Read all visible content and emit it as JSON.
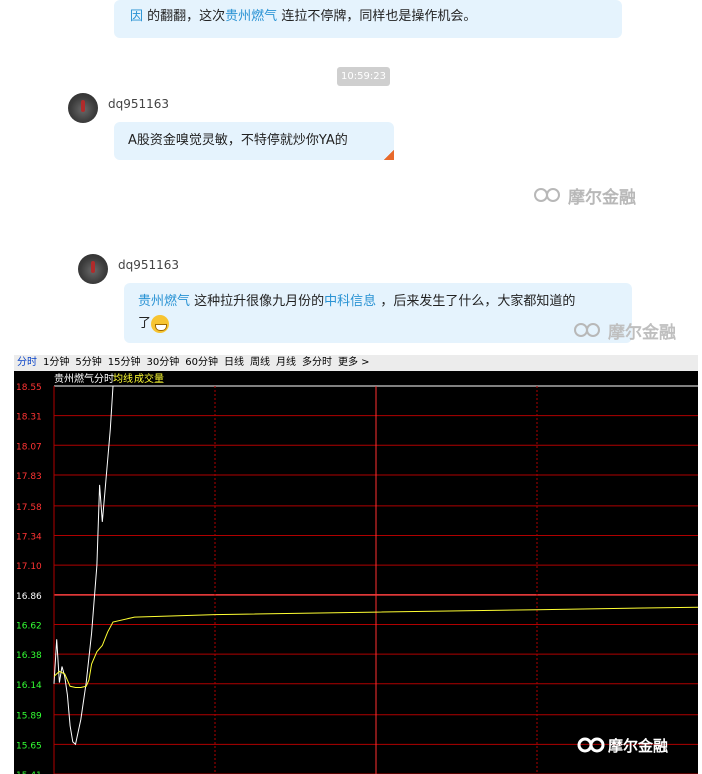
{
  "chat": {
    "top_bubble": {
      "line1": "因",
      "line1_rest": "的翻翻，这次",
      "link": "贵州燃气",
      "line1_end": "连拉不停牌，同样也是操作机会。"
    },
    "timestamp": "10:59:23",
    "messages": [
      {
        "user": "dq951163",
        "text": "A股资金嗅觉灵敏，不特停就炒你YA的"
      },
      {
        "user": "dq951163",
        "link1": "贵州燃气",
        "text1": "这种拉升很像九月份的",
        "link2": "中科信息",
        "text2": "，后来发生了什么，大家都知道的",
        "text3": "了"
      }
    ],
    "watermark": "摩尔金融"
  },
  "chart_panel": {
    "tabs": [
      "分时",
      "1分钟",
      "5分钟",
      "15分钟",
      "30分钟",
      "60分钟",
      "日线",
      "周线",
      "月线",
      "多分时",
      "更多 >"
    ],
    "stock_name": "贵州燃气",
    "mode_label": "分时",
    "ma_label": "均线",
    "volume_label": "成交量",
    "logo_text": "摩尔金融",
    "colors": {
      "up": "#ff3333",
      "down": "#33ff33",
      "price": "#ffffff",
      "avg": "#ffff33",
      "grid": "#b00000",
      "base": "#ffffff"
    }
  },
  "chart_data": {
    "type": "line",
    "title": "",
    "xlabel": "",
    "ylabel": "",
    "prev_close": 16.86,
    "ylim": [
      15.41,
      18.55
    ],
    "y_ticks": [
      18.55,
      18.31,
      18.07,
      17.83,
      17.58,
      17.34,
      17.1,
      16.86,
      16.62,
      16.38,
      16.14,
      15.89,
      15.65,
      15.41
    ],
    "series": [
      {
        "x": [
          0,
          1,
          2,
          3,
          4,
          5,
          6,
          7,
          8,
          10,
          12,
          14,
          16,
          17,
          18,
          19,
          21,
          22,
          23,
          24,
          25
        ],
        "values": [
          16.14,
          16.5,
          16.15,
          16.28,
          16.2,
          16.05,
          15.8,
          15.67,
          15.65,
          15.85,
          16.15,
          16.55,
          17.1,
          17.75,
          17.45,
          17.7,
          18.2,
          18.55,
          18.55,
          18.55,
          18.55
        ]
      },
      {
        "x": [
          0,
          2,
          4,
          6,
          8,
          10,
          12,
          13,
          14,
          16,
          18,
          20,
          22,
          30,
          60,
          120,
          180,
          240
        ],
        "values": [
          16.2,
          16.24,
          16.22,
          16.12,
          16.11,
          16.11,
          16.12,
          16.17,
          16.3,
          16.4,
          16.45,
          16.56,
          16.64,
          16.68,
          16.7,
          16.72,
          16.74,
          16.76
        ]
      }
    ],
    "x_range": [
      0,
      240
    ],
    "grid": true
  }
}
